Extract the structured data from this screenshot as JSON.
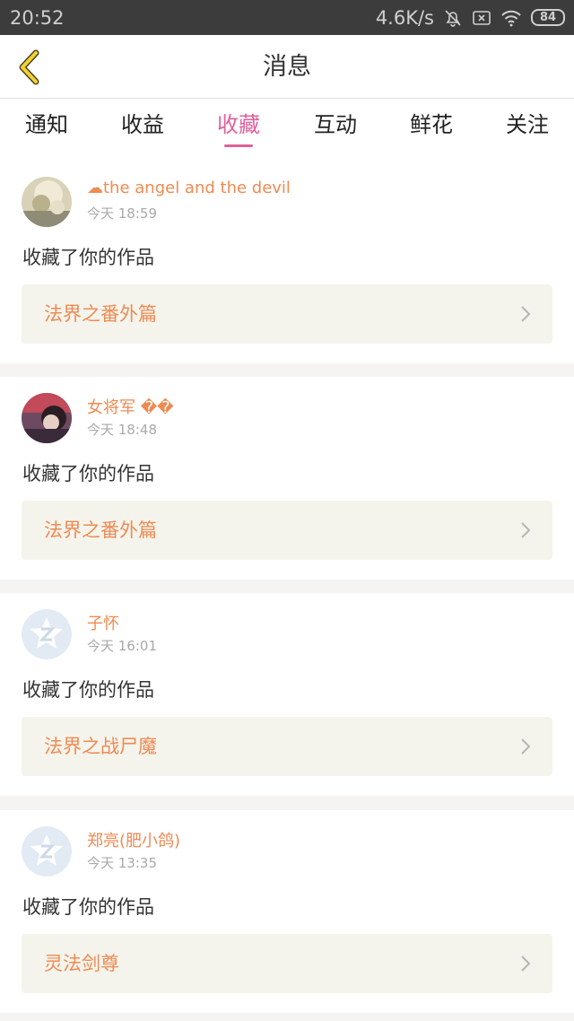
{
  "status_bar": {
    "time": "20:52",
    "network_speed": "4.6K/s",
    "battery": "84",
    "icons": [
      "bell-off-icon",
      "sim-x-icon",
      "wifi-icon",
      "battery-icon"
    ]
  },
  "header": {
    "title": "消息",
    "back_icon": "chevron-left-icon"
  },
  "tabs": [
    {
      "label": "通知",
      "active": false
    },
    {
      "label": "收益",
      "active": false
    },
    {
      "label": "收藏",
      "active": true
    },
    {
      "label": "互动",
      "active": false
    },
    {
      "label": "鲜花",
      "active": false
    },
    {
      "label": "关注",
      "active": false
    }
  ],
  "colors": {
    "accent": "#e0609b",
    "name": "#ef8a52",
    "work_bg": "#f5f4ec"
  },
  "messages": [
    {
      "name": "☁the angel and the devil",
      "time": "今天 18:59",
      "action": "收藏了你的作品",
      "work": "法界之番外篇",
      "avatar": "photo-avatar"
    },
    {
      "name": "女将军 ��",
      "time": "今天 18:48",
      "action": "收藏了你的作品",
      "work": "法界之番外篇",
      "avatar": "photo-avatar"
    },
    {
      "name": "子怀",
      "time": "今天 16:01",
      "action": "收藏了你的作品",
      "work": "法界之战尸魔",
      "avatar": "default-avatar"
    },
    {
      "name": "郑亮(肥小鸽)",
      "time": "今天 13:35",
      "action": "收藏了你的作品",
      "work": "灵法剑尊",
      "avatar": "default-avatar"
    }
  ]
}
